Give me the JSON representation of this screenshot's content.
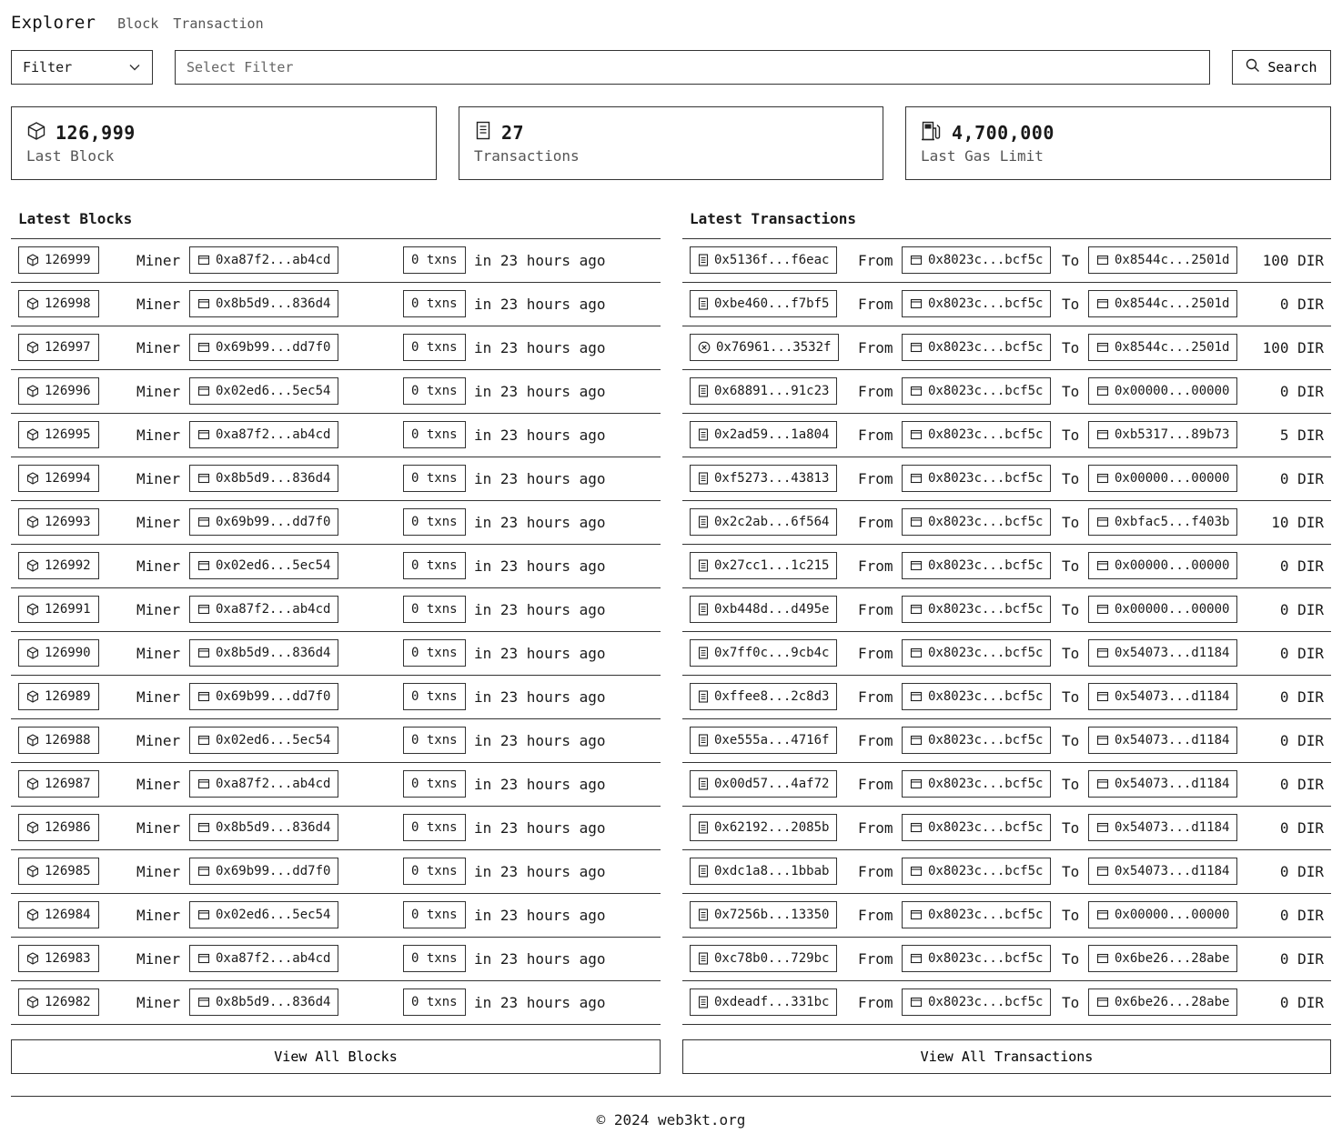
{
  "header": {
    "brand": "Explorer",
    "nav": [
      "Block",
      "Transaction"
    ]
  },
  "search": {
    "filter_label": "Filter",
    "placeholder": "Select Filter",
    "button_label": "Search"
  },
  "stats": [
    {
      "icon": "cube-icon",
      "value": "126,999",
      "label": "Last Block"
    },
    {
      "icon": "document-icon",
      "value": "27",
      "label": "Transactions"
    },
    {
      "icon": "fuel-pump-icon",
      "value": "4,700,000",
      "label": "Last Gas Limit"
    }
  ],
  "blocks": {
    "title": "Latest Blocks",
    "miner_label": "Miner",
    "view_all": "View All Blocks",
    "rows": [
      {
        "number": "126999",
        "miner": "0xa87f2...ab4cd",
        "txns": "0 txns",
        "time": "in 23 hours ago"
      },
      {
        "number": "126998",
        "miner": "0x8b5d9...836d4",
        "txns": "0 txns",
        "time": "in 23 hours ago"
      },
      {
        "number": "126997",
        "miner": "0x69b99...dd7f0",
        "txns": "0 txns",
        "time": "in 23 hours ago"
      },
      {
        "number": "126996",
        "miner": "0x02ed6...5ec54",
        "txns": "0 txns",
        "time": "in 23 hours ago"
      },
      {
        "number": "126995",
        "miner": "0xa87f2...ab4cd",
        "txns": "0 txns",
        "time": "in 23 hours ago"
      },
      {
        "number": "126994",
        "miner": "0x8b5d9...836d4",
        "txns": "0 txns",
        "time": "in 23 hours ago"
      },
      {
        "number": "126993",
        "miner": "0x69b99...dd7f0",
        "txns": "0 txns",
        "time": "in 23 hours ago"
      },
      {
        "number": "126992",
        "miner": "0x02ed6...5ec54",
        "txns": "0 txns",
        "time": "in 23 hours ago"
      },
      {
        "number": "126991",
        "miner": "0xa87f2...ab4cd",
        "txns": "0 txns",
        "time": "in 23 hours ago"
      },
      {
        "number": "126990",
        "miner": "0x8b5d9...836d4",
        "txns": "0 txns",
        "time": "in 23 hours ago"
      },
      {
        "number": "126989",
        "miner": "0x69b99...dd7f0",
        "txns": "0 txns",
        "time": "in 23 hours ago"
      },
      {
        "number": "126988",
        "miner": "0x02ed6...5ec54",
        "txns": "0 txns",
        "time": "in 23 hours ago"
      },
      {
        "number": "126987",
        "miner": "0xa87f2...ab4cd",
        "txns": "0 txns",
        "time": "in 23 hours ago"
      },
      {
        "number": "126986",
        "miner": "0x8b5d9...836d4",
        "txns": "0 txns",
        "time": "in 23 hours ago"
      },
      {
        "number": "126985",
        "miner": "0x69b99...dd7f0",
        "txns": "0 txns",
        "time": "in 23 hours ago"
      },
      {
        "number": "126984",
        "miner": "0x02ed6...5ec54",
        "txns": "0 txns",
        "time": "in 23 hours ago"
      },
      {
        "number": "126983",
        "miner": "0xa87f2...ab4cd",
        "txns": "0 txns",
        "time": "in 23 hours ago"
      },
      {
        "number": "126982",
        "miner": "0x8b5d9...836d4",
        "txns": "0 txns",
        "time": "in 23 hours ago"
      }
    ]
  },
  "transactions": {
    "title": "Latest Transactions",
    "from_label": "From",
    "to_label": "To",
    "view_all": "View All Transactions",
    "rows": [
      {
        "hash": "0x5136f...f6eac",
        "status": "ok",
        "from": "0x8023c...bcf5c",
        "to": "0x8544c...2501d",
        "amount": "100 DIR"
      },
      {
        "hash": "0xbe460...f7bf5",
        "status": "ok",
        "from": "0x8023c...bcf5c",
        "to": "0x8544c...2501d",
        "amount": "0 DIR"
      },
      {
        "hash": "0x76961...3532f",
        "status": "failed",
        "from": "0x8023c...bcf5c",
        "to": "0x8544c...2501d",
        "amount": "100 DIR"
      },
      {
        "hash": "0x68891...91c23",
        "status": "ok",
        "from": "0x8023c...bcf5c",
        "to": "0x00000...00000",
        "amount": "0 DIR"
      },
      {
        "hash": "0x2ad59...1a804",
        "status": "ok",
        "from": "0x8023c...bcf5c",
        "to": "0xb5317...89b73",
        "amount": "5 DIR"
      },
      {
        "hash": "0xf5273...43813",
        "status": "ok",
        "from": "0x8023c...bcf5c",
        "to": "0x00000...00000",
        "amount": "0 DIR"
      },
      {
        "hash": "0x2c2ab...6f564",
        "status": "ok",
        "from": "0x8023c...bcf5c",
        "to": "0xbfac5...f403b",
        "amount": "10 DIR"
      },
      {
        "hash": "0x27cc1...1c215",
        "status": "ok",
        "from": "0x8023c...bcf5c",
        "to": "0x00000...00000",
        "amount": "0 DIR"
      },
      {
        "hash": "0xb448d...d495e",
        "status": "ok",
        "from": "0x8023c...bcf5c",
        "to": "0x00000...00000",
        "amount": "0 DIR"
      },
      {
        "hash": "0x7ff0c...9cb4c",
        "status": "ok",
        "from": "0x8023c...bcf5c",
        "to": "0x54073...d1184",
        "amount": "0 DIR"
      },
      {
        "hash": "0xffee8...2c8d3",
        "status": "ok",
        "from": "0x8023c...bcf5c",
        "to": "0x54073...d1184",
        "amount": "0 DIR"
      },
      {
        "hash": "0xe555a...4716f",
        "status": "ok",
        "from": "0x8023c...bcf5c",
        "to": "0x54073...d1184",
        "amount": "0 DIR"
      },
      {
        "hash": "0x00d57...4af72",
        "status": "ok",
        "from": "0x8023c...bcf5c",
        "to": "0x54073...d1184",
        "amount": "0 DIR"
      },
      {
        "hash": "0x62192...2085b",
        "status": "ok",
        "from": "0x8023c...bcf5c",
        "to": "0x54073...d1184",
        "amount": "0 DIR"
      },
      {
        "hash": "0xdc1a8...1bbab",
        "status": "ok",
        "from": "0x8023c...bcf5c",
        "to": "0x54073...d1184",
        "amount": "0 DIR"
      },
      {
        "hash": "0x7256b...13350",
        "status": "ok",
        "from": "0x8023c...bcf5c",
        "to": "0x00000...00000",
        "amount": "0 DIR"
      },
      {
        "hash": "0xc78b0...729bc",
        "status": "ok",
        "from": "0x8023c...bcf5c",
        "to": "0x6be26...28abe",
        "amount": "0 DIR"
      },
      {
        "hash": "0xdeadf...331bc",
        "status": "ok",
        "from": "0x8023c...bcf5c",
        "to": "0x6be26...28abe",
        "amount": "0 DIR"
      }
    ]
  },
  "footer": {
    "text": "© 2024 web3kt.org"
  }
}
